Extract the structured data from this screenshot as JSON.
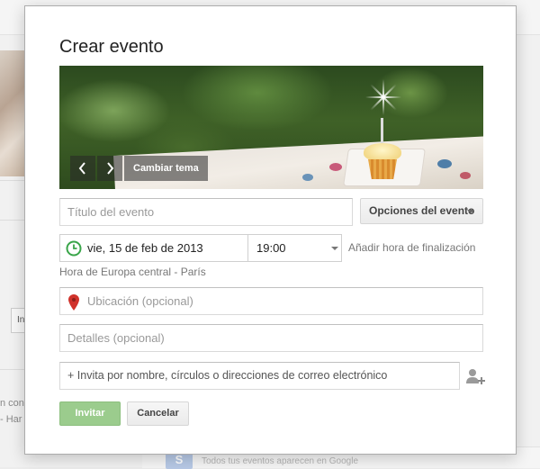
{
  "background": {
    "left_snippets": [
      "In",
      "n con",
      "- Har"
    ],
    "bottom_icon_letter": "S",
    "bottom_text": "Todos tus eventos aparecen en Google"
  },
  "dialog": {
    "title": "Crear evento",
    "banner": {
      "prev_icon": "chevron-left-icon",
      "next_icon": "chevron-right-icon",
      "change_theme_label": "Cambiar tema"
    },
    "title_input": {
      "placeholder": "Título del evento",
      "value": ""
    },
    "event_options_label": "Opciones del evento",
    "date_value": "vie, 15 de feb de 2013",
    "time_value": "19:00",
    "add_end_time_label": "Añadir hora de finalización",
    "timezone_text": "Hora de Europa central - París",
    "location_input": {
      "placeholder": "Ubicación (opcional)",
      "value": ""
    },
    "details_input": {
      "placeholder": "Detalles (opcional)",
      "value": ""
    },
    "invite_input": {
      "placeholder": "+ Invita por nombre, círculos o direcciones de correo electrónico",
      "value": ""
    },
    "invite_button": "Invitar",
    "cancel_button": "Cancelar"
  },
  "colors": {
    "invite_green": "#9bcc8d",
    "clock_green": "#3aa54a",
    "pin_red": "#d0322b"
  }
}
